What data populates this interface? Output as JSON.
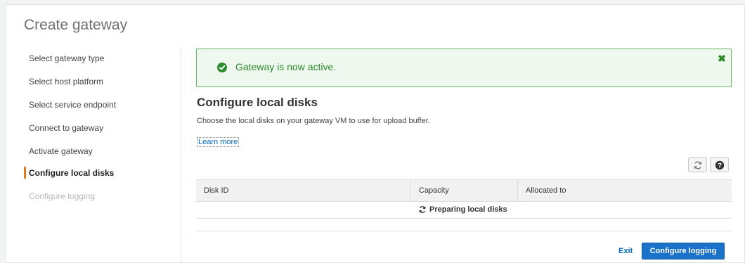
{
  "page": {
    "title": "Create gateway"
  },
  "steps": [
    {
      "label": "Select gateway type",
      "state": "complete"
    },
    {
      "label": "Select host platform",
      "state": "complete"
    },
    {
      "label": "Select service endpoint",
      "state": "complete"
    },
    {
      "label": "Connect to gateway",
      "state": "complete"
    },
    {
      "label": "Activate gateway",
      "state": "complete"
    },
    {
      "label": "Configure local disks",
      "state": "active"
    },
    {
      "label": "Configure logging",
      "state": "disabled"
    }
  ],
  "alert": {
    "text": "Gateway is now active.",
    "close_icon": "close-icon",
    "status_icon": "check-circle-icon",
    "color": "#2c8a2c"
  },
  "section": {
    "title": "Configure local disks",
    "description": "Choose the local disks on your gateway VM to use for upload buffer.",
    "learn_more": "Learn more"
  },
  "toolbar": {
    "refresh_icon": "refresh-icon",
    "help_icon": "help-icon"
  },
  "table": {
    "columns": [
      "Disk ID",
      "Capacity",
      "Allocated to"
    ],
    "loading_text": "Preparing local disks"
  },
  "footer": {
    "exit_label": "Exit",
    "next_label": "Configure logging",
    "accent": "#1a73c9"
  }
}
